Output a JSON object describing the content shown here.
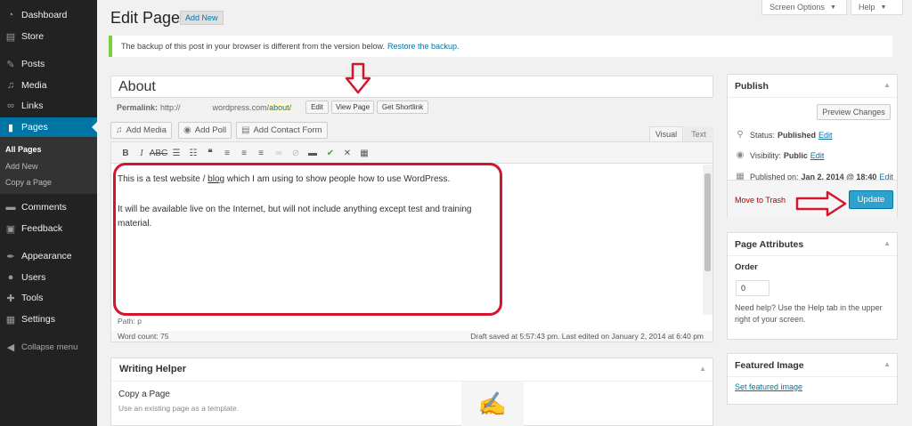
{
  "sidebar": {
    "items": [
      {
        "label": "Dashboard",
        "icon": "dashboard-icon"
      },
      {
        "label": "Store",
        "icon": "store-icon"
      },
      {
        "label": "Posts",
        "icon": "pin-icon"
      },
      {
        "label": "Media",
        "icon": "media-icon"
      },
      {
        "label": "Links",
        "icon": "links-icon"
      },
      {
        "label": "Pages",
        "icon": "pages-icon"
      },
      {
        "label": "Comments",
        "icon": "comments-icon"
      },
      {
        "label": "Feedback",
        "icon": "feedback-icon"
      },
      {
        "label": "Appearance",
        "icon": "appearance-icon"
      },
      {
        "label": "Users",
        "icon": "users-icon"
      },
      {
        "label": "Tools",
        "icon": "tools-icon"
      },
      {
        "label": "Settings",
        "icon": "settings-icon"
      },
      {
        "label": "Collapse menu",
        "icon": "collapse-icon"
      }
    ],
    "pages_sub": [
      "All Pages",
      "Add New",
      "Copy a Page"
    ]
  },
  "header": {
    "title": "Edit Page",
    "add_new": "Add New",
    "screen_options": "Screen Options",
    "help": "Help"
  },
  "notice": {
    "text": "The backup of this post in your browser is different from the version below.",
    "link": "Restore the backup."
  },
  "post": {
    "title": "About",
    "permalink_label": "Permalink:",
    "permalink_prefix": "http://",
    "permalink_domain": "wordpress.com/",
    "permalink_slug": "about/",
    "btn_edit": "Edit",
    "btn_view": "View Page",
    "btn_shortlink": "Get Shortlink"
  },
  "media_buttons": {
    "add_media": "Add Media",
    "add_poll": "Add Poll",
    "add_contact": "Add Contact Form"
  },
  "editor": {
    "tab_visual": "Visual",
    "tab_text": "Text",
    "para1_pre": "This is a test website / ",
    "para1_link": "blog",
    "para1_post": " which I am using to show people how to use WordPress.",
    "para2": "It will be available live on the Internet, but will not include anything except test and training material.",
    "path": "Path: p",
    "word_count": "Word count: 75",
    "draft_status": "Draft saved at 5:57:43 pm. Last edited on January 2, 2014 at 6:40 pm"
  },
  "writing_helper": {
    "title": "Writing Helper",
    "item_title": "Copy a Page",
    "item_desc": "Use an existing page as a template."
  },
  "publish": {
    "title": "Publish",
    "preview": "Preview Changes",
    "status_label": "Status:",
    "status_value": "Published",
    "visibility_label": "Visibility:",
    "visibility_value": "Public",
    "published_label": "Published on:",
    "published_value": "Jan 2, 2014 @ 18:40",
    "edit": "Edit",
    "trash": "Move to Trash",
    "update": "Update"
  },
  "page_attributes": {
    "title": "Page Attributes",
    "order_label": "Order",
    "order_value": "0",
    "help": "Need help? Use the Help tab in the upper right of your screen."
  },
  "featured_image": {
    "title": "Featured Image",
    "link": "Set featured image"
  },
  "colors": {
    "accent": "#0074a2",
    "annotation": "#d1162d"
  }
}
